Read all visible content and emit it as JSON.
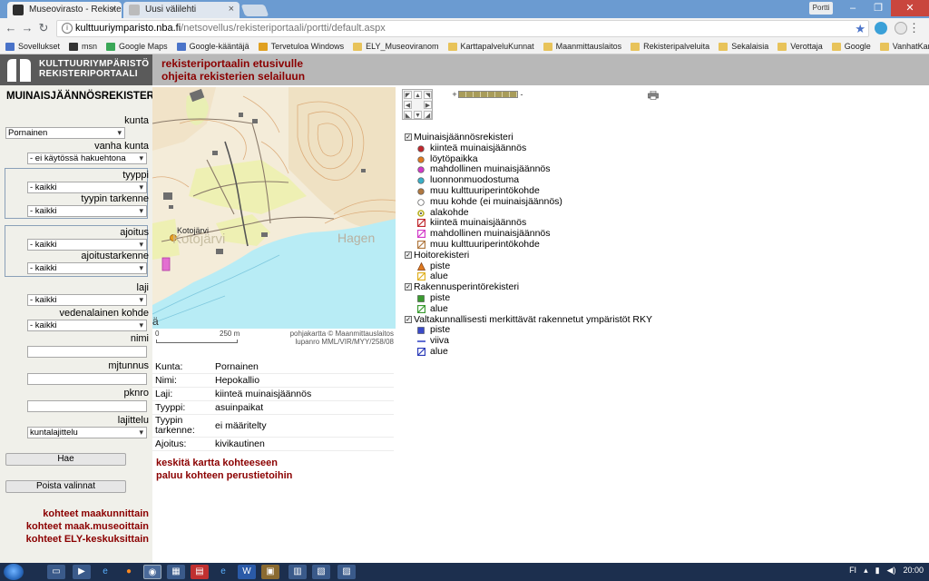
{
  "browser": {
    "tabs": [
      {
        "title": "Museovirasto - Rekisteri"
      },
      {
        "title": "Uusi välilehti"
      }
    ],
    "window_title": "...",
    "user_button": "Portti",
    "url_host": "kulttuuriymparisto.nba.fi",
    "url_path": "/netsovellus/rekisteriportaali/portti/default.aspx",
    "bookmarks": [
      {
        "label": "Sovellukset",
        "icon": "apps-icon",
        "color": "#4a73c9"
      },
      {
        "label": "msn",
        "icon": "msn-icon",
        "color": "#333333"
      },
      {
        "label": "Google Maps",
        "icon": "maps-icon",
        "color": "#3aa757"
      },
      {
        "label": "Google-kääntäjä",
        "icon": "translate-icon",
        "color": "#4a73c9"
      },
      {
        "label": "Tervetuloa Windows",
        "icon": "windows-icon",
        "color": "#e0a020"
      },
      {
        "label": "ELY_Museoviranom",
        "icon": "folder-icon",
        "color": "#e8c35a"
      },
      {
        "label": "KarttapalveluKunnat",
        "icon": "folder-icon",
        "color": "#e8c35a"
      },
      {
        "label": "Maanmittauslaitos",
        "icon": "folder-icon",
        "color": "#e8c35a"
      },
      {
        "label": "Rekisteripalveluita",
        "icon": "folder-icon",
        "color": "#e8c35a"
      },
      {
        "label": "Sekalaisia",
        "icon": "folder-icon",
        "color": "#e8c35a"
      },
      {
        "label": "Verottaja",
        "icon": "folder-icon",
        "color": "#e8c35a"
      },
      {
        "label": "Google",
        "icon": "folder-icon",
        "color": "#e8c35a"
      },
      {
        "label": "VanhatKartat",
        "icon": "folder-icon",
        "color": "#e8c35a"
      }
    ]
  },
  "header": {
    "logo_line1": "KULTTUURIYMPÄRISTÖ",
    "logo_line2": "REKISTERIPORTAALI",
    "link1": "rekisteriportaalin etusivulle",
    "link2": "ohjeita rekisterien selailuun"
  },
  "sidebar": {
    "title": "MUINAISJÄÄNNÖSREKISTERI",
    "kunta_label": "kunta",
    "kunta_value": "Pornainen",
    "vanha_kunta_label": "vanha kunta",
    "vanha_kunta_value": "- ei käytössä hakuehtona",
    "tyyppi_label": "tyyppi",
    "tyyppi_value": "- kaikki",
    "tyypin_tarkenne_label": "tyypin tarkenne",
    "tyypin_tarkenne_value": "- kaikki",
    "ajoitus_label": "ajoitus",
    "ajoitus_value": "- kaikki",
    "ajoitustarkenne_label": "ajoitustarkenne",
    "ajoitustarkenne_value": "- kaikki",
    "laji_label": "laji",
    "laji_value": "- kaikki",
    "vedenalainen_label": "vedenalainen kohde",
    "vedenalainen_value": "- kaikki",
    "nimi_label": "nimi",
    "nimi_value": "",
    "mjtunnus_label": "mjtunnus",
    "mjtunnus_value": "",
    "pknro_label": "pknro",
    "pknro_value": "",
    "lajittelu_label": "lajittelu",
    "lajittelu_value": "kuntalajittelu",
    "hae_button": "Hae",
    "poista_button": "Poista valinnat",
    "links": [
      "kohteet maakunnittain",
      "kohteet maak.museoittain",
      "kohteet ELY-keskuksittain"
    ]
  },
  "map": {
    "place_labels": [
      "Kotojärvi",
      "Kotojärvi",
      "Hagen",
      "ä"
    ],
    "scale_zero": "0",
    "scale_label": "250 m",
    "credit_line1": "pohjakartta © Maanmittauslaitos",
    "credit_line2": "lupanro MML/VIR/MYY/258/08",
    "zoom_minus": "-",
    "zoom_plus": "+"
  },
  "details": {
    "rows": [
      {
        "key": "Kunta:",
        "value": "Pornainen"
      },
      {
        "key": "Nimi:",
        "value": "Hepokallio"
      },
      {
        "key": "Laji:",
        "value": "kiinteä muinaisjäännös"
      },
      {
        "key": "Tyyppi:",
        "value": "asuinpaikat"
      },
      {
        "key": "Tyypin tarkenne:",
        "value": "ei määritelty"
      },
      {
        "key": "Ajoitus:",
        "value": "kivikautinen"
      }
    ],
    "link_center": "keskitä kartta kohteeseen",
    "link_back": "paluu kohteen perustietoihin"
  },
  "legend": {
    "groups": [
      {
        "title": "Muinaisjäännösrekisteri",
        "checked": true,
        "items": [
          {
            "label": "kiinteä muinaisjäännös",
            "symbol": "dot",
            "color": "#c0282d"
          },
          {
            "label": "löytöpaikka",
            "symbol": "dot",
            "color": "#e07a20"
          },
          {
            "label": "mahdollinen muinaisjäännös",
            "symbol": "dot",
            "color": "#d23ac8"
          },
          {
            "label": "luonnonmuodostuma",
            "symbol": "dot",
            "color": "#3ab0c8"
          },
          {
            "label": "muu kulttuuriperintökohde",
            "symbol": "dot",
            "color": "#b07840"
          },
          {
            "label": "muu kohde (ei muinaisjäännös)",
            "symbol": "dot",
            "color": "#ffffff"
          },
          {
            "label": "alakohde",
            "symbol": "ring",
            "color": "#b8b020"
          },
          {
            "label": "kiinteä muinaisjäännös",
            "symbol": "area",
            "color": "#c0282d"
          },
          {
            "label": "mahdollinen muinaisjäännös",
            "symbol": "area",
            "color": "#d23ac8"
          },
          {
            "label": "muu kulttuuriperintökohde",
            "symbol": "area",
            "color": "#b07840"
          }
        ]
      },
      {
        "title": "Hoitorekisteri",
        "checked": true,
        "items": [
          {
            "label": "piste",
            "symbol": "triangle",
            "color": "#e07a20"
          },
          {
            "label": "alue",
            "symbol": "area",
            "color": "#e0b020"
          }
        ]
      },
      {
        "title": "Rakennusperintörekisteri",
        "checked": true,
        "items": [
          {
            "label": "piste",
            "symbol": "square",
            "color": "#3a9a30"
          },
          {
            "label": "alue",
            "symbol": "area",
            "color": "#3a9a30"
          }
        ]
      },
      {
        "title": "Valtakunnallisesti merkittävät rakennetut ympäristöt RKY",
        "checked": true,
        "items": [
          {
            "label": "piste",
            "symbol": "square",
            "color": "#3a4ac8"
          },
          {
            "label": "viiva",
            "symbol": "line",
            "color": "#3a4ac8"
          },
          {
            "label": "alue",
            "symbol": "area",
            "color": "#2a3ab8"
          }
        ]
      }
    ]
  },
  "taskbar": {
    "lang": "FI",
    "time": "20:00"
  }
}
